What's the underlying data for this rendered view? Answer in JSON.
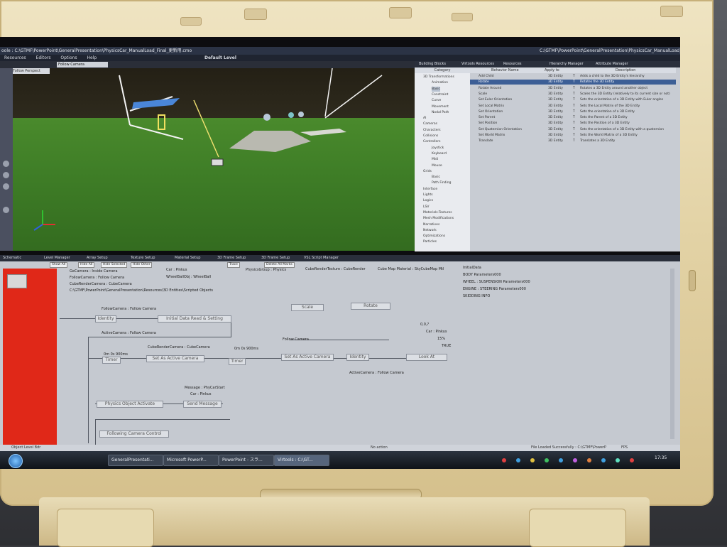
{
  "window": {
    "title": "oole : C:\\GTMF\\PowerPoint\\GeneralPresentation\\PhysicsCar_ManualLoad_Final_更新用.cmo",
    "title_right": "C:\\GTMF\\PowerPoint\\GeneralPresentation\\PhysicsCar_ManualLoad_Final_更新用.cmo"
  },
  "menu": {
    "items": [
      "Resources",
      "Editors",
      "Options",
      "Help"
    ],
    "center_label": "Default Level"
  },
  "viewport": {
    "camera_select": "Follow Camera",
    "tab_label": "Follow Perspect"
  },
  "building_blocks": {
    "tabs": [
      "Building Blocks",
      "Virtools Resources",
      "Resources",
      "Hierarchy Manager",
      "Attribute Manager"
    ],
    "category_header": "Category",
    "columns": [
      "Behavior Name",
      "Apply to",
      "",
      "Description"
    ],
    "categories": [
      {
        "label": "3D Transformations",
        "level": 0
      },
      {
        "label": "Animation",
        "level": 1
      },
      {
        "label": "Basic",
        "level": 1,
        "selected": true
      },
      {
        "label": "Constraint",
        "level": 1
      },
      {
        "label": "Curve",
        "level": 1
      },
      {
        "label": "Movement",
        "level": 1
      },
      {
        "label": "Nodal Path",
        "level": 1
      },
      {
        "label": "AI",
        "level": 0
      },
      {
        "label": "Cameras",
        "level": 0
      },
      {
        "label": "Characters",
        "level": 0
      },
      {
        "label": "Collisions",
        "level": 0
      },
      {
        "label": "Controllers",
        "level": 0
      },
      {
        "label": "Joystick",
        "level": 1
      },
      {
        "label": "Keyboard",
        "level": 1
      },
      {
        "label": "Midi",
        "level": 1
      },
      {
        "label": "Mouse",
        "level": 1
      },
      {
        "label": "Grids",
        "level": 0
      },
      {
        "label": "Basic",
        "level": 1
      },
      {
        "label": "Path Finding",
        "level": 1
      },
      {
        "label": "Interface",
        "level": 0
      },
      {
        "label": "Lights",
        "level": 0
      },
      {
        "label": "Logics",
        "level": 0
      },
      {
        "label": "LSV",
        "level": 0
      },
      {
        "label": "Materials-Textures",
        "level": 0
      },
      {
        "label": "Mesh Modifications",
        "level": 0
      },
      {
        "label": "Narratives",
        "level": 0
      },
      {
        "label": "Network",
        "level": 0
      },
      {
        "label": "Optimizations",
        "level": 0
      },
      {
        "label": "Particles",
        "level": 0
      }
    ],
    "behaviors": [
      {
        "name": "Add Child",
        "apply": "3D Entity",
        "flag": "T",
        "desc": "Adds a child to the 3D Entity's hierarchy"
      },
      {
        "name": "Rotate",
        "apply": "3D Entity",
        "flag": "T",
        "desc": "Rotates the 3D Entity",
        "selected": true
      },
      {
        "name": "Rotate Around",
        "apply": "3D Entity",
        "flag": "T",
        "desc": "Rotates a 3D Entity around another object"
      },
      {
        "name": "Scale",
        "apply": "3D Entity",
        "flag": "T",
        "desc": "Scales the 3D Entity (relatively to its current size or not)"
      },
      {
        "name": "Set Euler Orientation",
        "apply": "3D Entity",
        "flag": "T",
        "desc": "Sets the orientation of a 3D Entity with Euler angles"
      },
      {
        "name": "Set Local Matrix",
        "apply": "3D Entity",
        "flag": "T",
        "desc": "Sets the Local Matrix of the 3D Entity"
      },
      {
        "name": "Set Orientation",
        "apply": "3D Entity",
        "flag": "T",
        "desc": "Sets the orientation of a 3D Entity"
      },
      {
        "name": "Set Parent",
        "apply": "3D Entity",
        "flag": "T",
        "desc": "Sets the Parent of a 3D Entity"
      },
      {
        "name": "Set Position",
        "apply": "3D Entity",
        "flag": "T",
        "desc": "Sets the Position of a 3D Entity"
      },
      {
        "name": "Set Quaternion Orientation",
        "apply": "3D Entity",
        "flag": "T",
        "desc": "Sets the orientation of a 3D Entity with a quaternion"
      },
      {
        "name": "Set World Matrix",
        "apply": "3D Entity",
        "flag": "T",
        "desc": "Sets the World Matrix of a 3D Entity"
      },
      {
        "name": "Translate",
        "apply": "3D Entity",
        "flag": "T",
        "desc": "Translates a 3D Entity"
      }
    ]
  },
  "schematic_tabs": [
    "Schematic",
    "Level Manager",
    "Array Setup",
    "Texture Setup",
    "Material Setup",
    "3D Frame Setup",
    "3D Frame Setup",
    "VSL Script Manager"
  ],
  "schematic": {
    "toolbar": [
      "Show All",
      "Hide All",
      "Hide Selected",
      "Hide Other",
      "Trace",
      "Delete All Marks"
    ],
    "params": [
      "GeCamera : Inside Camera",
      "FollowCamera : Follow Camera",
      "CubeRenderCamera : CubeCamera",
      "C:\\GTMF\\PowerPoint\\GeneralPresentation\\Resources\\3D Entities\\Scripted Objects",
      "Car : Pinkus",
      "WheelBallObj : WheelBall",
      "PhysicsGroup : Physics",
      "CubeRenderTexture : CubeRender",
      "Cube Map Material : SkyCubeMap Mtl"
    ],
    "right_list": [
      "InitialData",
      "BODY Parameters000",
      "WHEEL : SUSPENSION Parameters000",
      "ENGINE : STEERING Parameters000",
      "SKIDDING INFO"
    ],
    "blocks": {
      "scale": "Scale",
      "rotate": "Rotate",
      "identity1": "Identity",
      "initial": "Initial Data Read & Setting",
      "timer1": "Timer",
      "set_cam1": "Set As Active Camera",
      "timer2": "Timer",
      "set_cam2": "Set As Active Camera",
      "identity2": "Identity",
      "lookat": "Look At",
      "physics": "Physics Object Activate",
      "send": "Send Message",
      "following": "Following Camera Control"
    },
    "labels": {
      "follow1": "FollowCamera : Follow Camera",
      "active1": "ActiveCamera : Follow Camera",
      "cube": "CubeRenderCamera : CubeCamera",
      "t1": "0m 0s 900ms",
      "t2": "0m 0s 900ms",
      "follow2": "Follow Camera",
      "active2": "ActiveCamera : Follow Camera",
      "vec": "0,0,?",
      "car": "Car : Pinkus",
      "pct": "15%",
      "true": "TRUE",
      "msg": "Message : PhyCarStart",
      "car2": "Car : Pinkus"
    }
  },
  "status": {
    "left": "Object Level Bdr",
    "center": "No action",
    "right": "File Loaded Successfully : C:\\GTMF\\PowerP",
    "fps": "FPS"
  },
  "taskbar": {
    "items": [
      "GeneralPresentati...",
      "Microsoft PowerP...",
      "PowerPoint - スラ...",
      "Virtools : C:\\GT..."
    ],
    "clock": "17:35"
  }
}
